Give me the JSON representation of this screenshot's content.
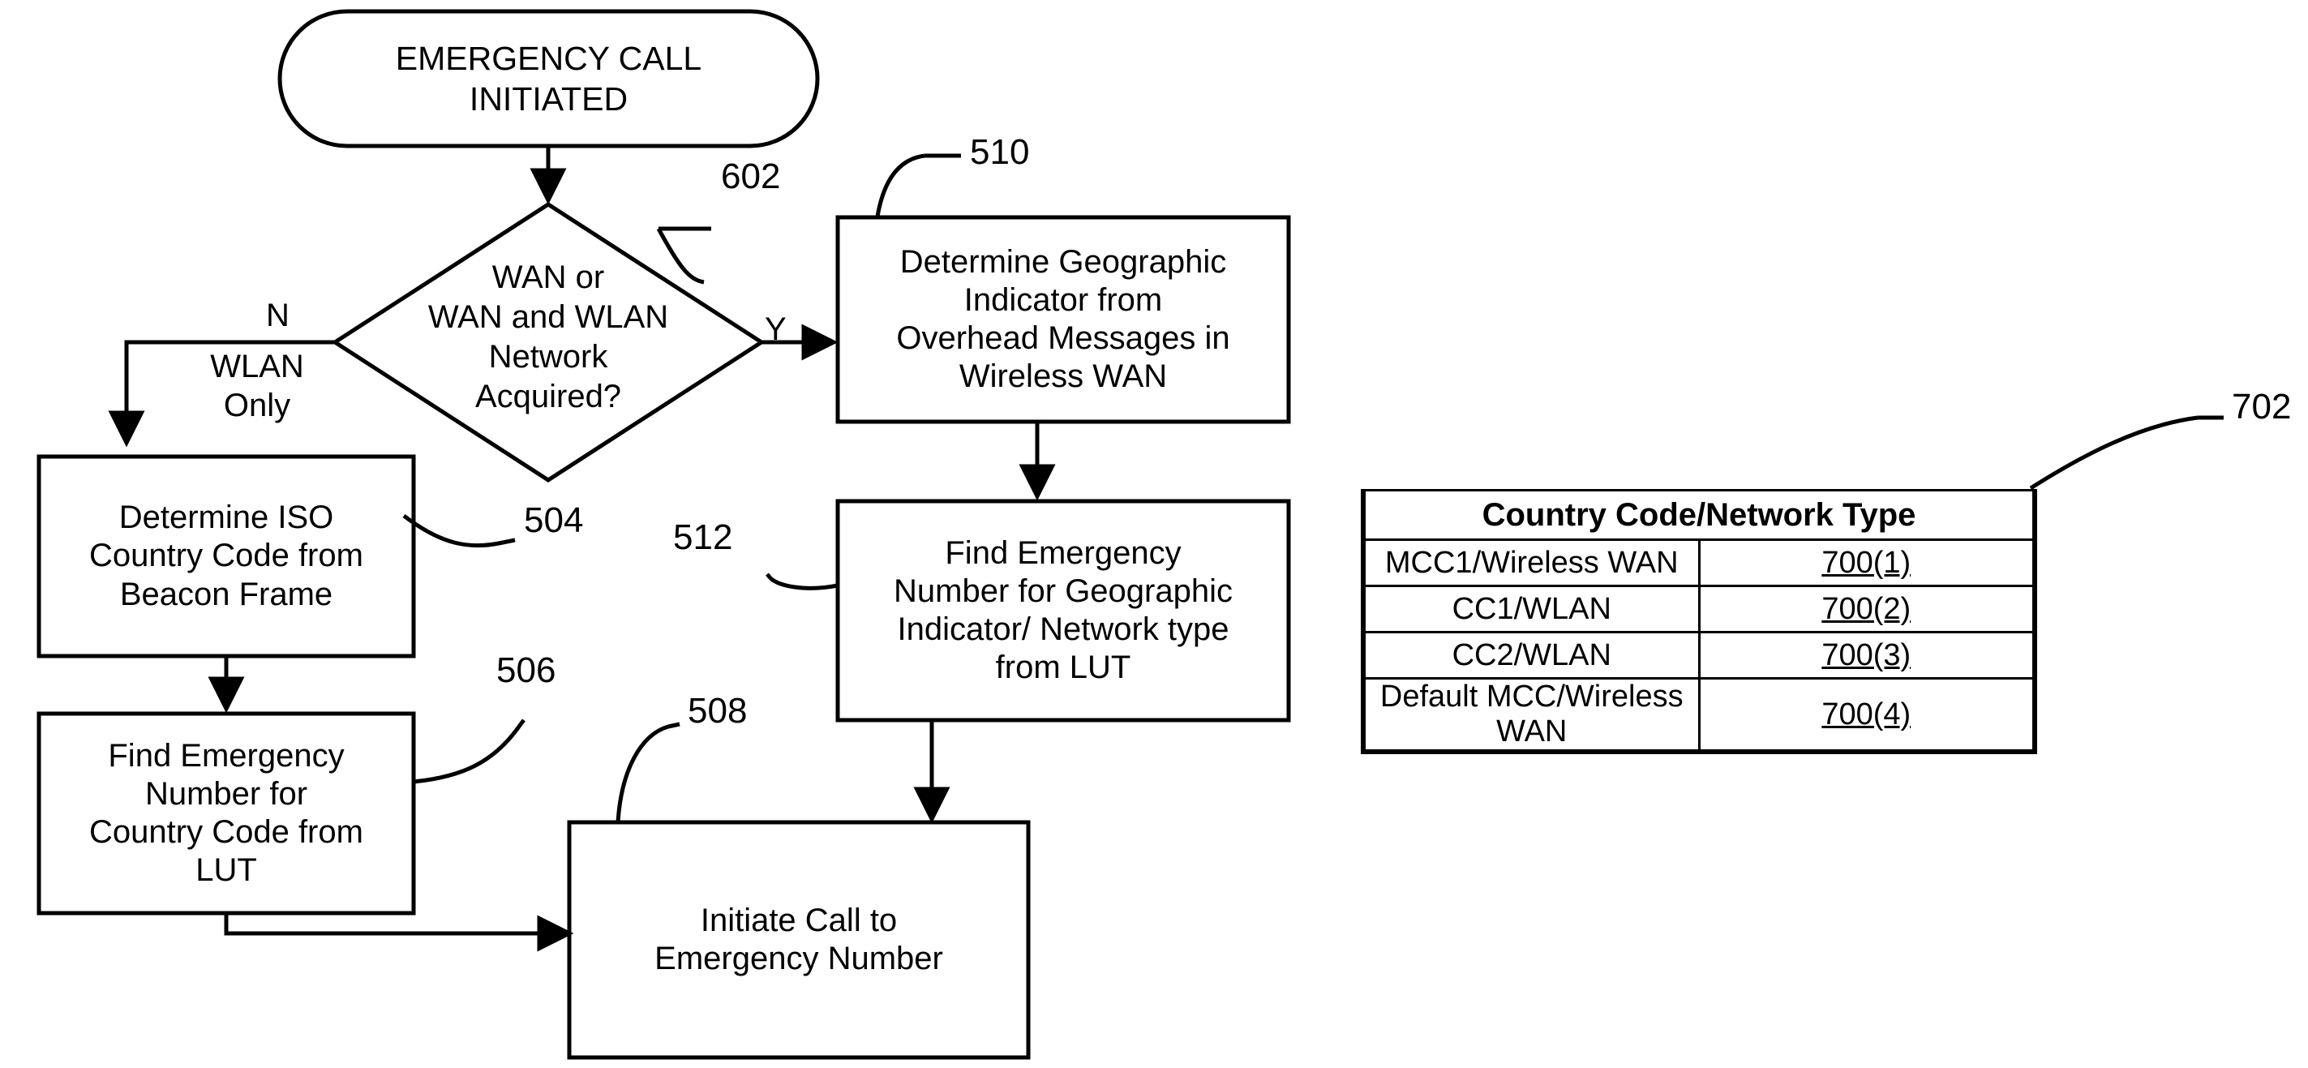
{
  "figure": {
    "type": "patent-flowchart",
    "start_node": {
      "label": "EMERGENCY CALL\nINITIATED"
    },
    "decision": {
      "label": "WAN or\nWAN and WLAN\nNetwork\nAcquired?",
      "ref": "602",
      "ref_below": "504",
      "yes_label": "Y",
      "no_label": "N",
      "no_sublabel": "WLAN\nOnly"
    },
    "process_boxes": [
      {
        "id": "determine-iso-country-code",
        "label": "Determine ISO\nCountry Code from\nBeacon Frame"
      },
      {
        "id": "find-emergency-number-country-code",
        "label": "Find Emergency\nNumber for\nCountry Code from\nLUT",
        "ref": "506"
      },
      {
        "id": "determine-geographic-indicator",
        "label": "Determine Geographic\nIndicator from\nOverhead Messages in\nWireless WAN",
        "ref": "510"
      },
      {
        "id": "find-emergency-number-geographic",
        "label": "Find Emergency\nNumber for Geographic\nIndicator/ Network type\nfrom LUT",
        "ref": "512"
      },
      {
        "id": "initiate-call",
        "label": "Initiate Call to\nEmergency Number",
        "ref": "508"
      }
    ],
    "lookup_table": {
      "ref": "702",
      "header": "Country Code/Network Type",
      "rows": [
        {
          "entry": "MCC1/Wireless WAN",
          "code": "700(1)"
        },
        {
          "entry": "CC1/WLAN",
          "code": "700(2)"
        },
        {
          "entry": "CC2/WLAN",
          "code": "700(3)"
        },
        {
          "entry": "Default MCC/Wireless WAN",
          "code": "700(4)"
        }
      ]
    },
    "colors": {
      "stroke": "#000000",
      "background": "#ffffff"
    }
  }
}
